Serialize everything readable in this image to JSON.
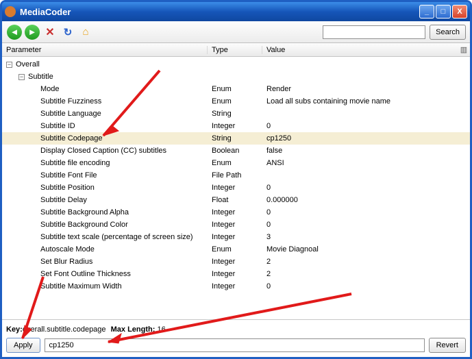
{
  "window": {
    "title": "MediaCoder"
  },
  "toolbar": {
    "search_placeholder": "",
    "search_label": "Search"
  },
  "columns": {
    "param": "Parameter",
    "type": "Type",
    "value": "Value"
  },
  "tree": {
    "root": "Overall",
    "sub": "Subtitle",
    "rows": [
      {
        "param": "Mode",
        "type": "Enum",
        "value": "Render",
        "selected": false
      },
      {
        "param": "Subtitle Fuzziness",
        "type": "Enum",
        "value": "Load all subs containing movie name",
        "selected": false
      },
      {
        "param": "Subtitle Language",
        "type": "String",
        "value": "",
        "selected": false
      },
      {
        "param": "Subtitle ID",
        "type": "Integer",
        "value": "0",
        "selected": false
      },
      {
        "param": "Subtitle Codepage",
        "type": "String",
        "value": "cp1250",
        "selected": true
      },
      {
        "param": "Display Closed Caption (CC) subtitles",
        "type": "Boolean",
        "value": "false",
        "selected": false
      },
      {
        "param": "Subtitle file encoding",
        "type": "Enum",
        "value": "ANSI",
        "selected": false
      },
      {
        "param": "Subtitle Font File",
        "type": "File Path",
        "value": "",
        "selected": false
      },
      {
        "param": "Subtitle Position",
        "type": "Integer",
        "value": "0",
        "selected": false
      },
      {
        "param": "Subtitle Delay",
        "type": "Float",
        "value": "0.000000",
        "selected": false
      },
      {
        "param": "Subtitle Background Alpha",
        "type": "Integer",
        "value": "0",
        "selected": false
      },
      {
        "param": "Subtitle Background Color",
        "type": "Integer",
        "value": "0",
        "selected": false
      },
      {
        "param": "Subtitle text scale (percentage of screen size)",
        "type": "Integer",
        "value": "3",
        "selected": false
      },
      {
        "param": "Autoscale Mode",
        "type": "Enum",
        "value": "Movie Diagnoal",
        "selected": false
      },
      {
        "param": "Set Blur Radius",
        "type": "Integer",
        "value": "2",
        "selected": false
      },
      {
        "param": "Set Font Outline Thickness",
        "type": "Integer",
        "value": "2",
        "selected": false
      },
      {
        "param": "Subtitle Maximum Width",
        "type": "Integer",
        "value": "0",
        "selected": false
      }
    ]
  },
  "footer": {
    "key_label": "Key:",
    "key_value": "overall.subtitle.codepage",
    "maxlen_label": "Max Length:",
    "maxlen_value": "16",
    "apply_label": "Apply",
    "revert_label": "Revert",
    "input_value": "cp1250"
  }
}
